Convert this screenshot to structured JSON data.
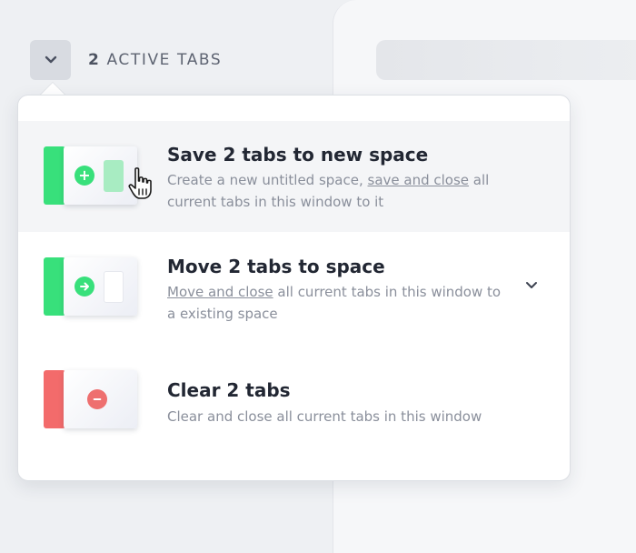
{
  "header": {
    "count": "2",
    "label": "ACTIVE TABS"
  },
  "options": [
    {
      "title": "Save 2 tabs to new space",
      "desc_before": "Create a new untitled space, ",
      "desc_link": "save and close",
      "desc_after": " all current tabs in this window to it",
      "icon": "plus-icon",
      "accent": "#38e07b"
    },
    {
      "title": "Move 2 tabs to space",
      "desc_before": "",
      "desc_link": "Move and close",
      "desc_after": " all current tabs in this window to a existing space",
      "icon": "arrow-right-icon",
      "accent": "#38e07b"
    },
    {
      "title": "Clear 2 tabs",
      "desc_before": "Clear and close all current tabs in this window",
      "desc_link": "",
      "desc_after": "",
      "icon": "minus-icon",
      "accent": "#f36b6b"
    }
  ],
  "colors": {
    "green": "#38e07b",
    "red": "#f36b6b",
    "text_dark": "#222733",
    "text_muted": "#8a8f9b"
  }
}
